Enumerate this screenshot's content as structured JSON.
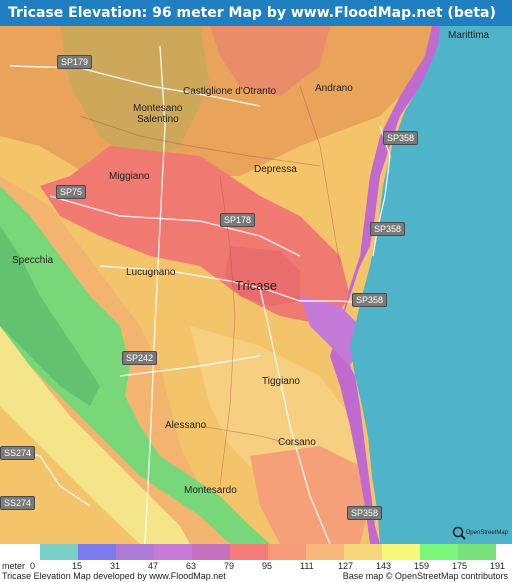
{
  "title": "Tricase Elevation: 96 meter Map by www.FloodMap.net (beta)",
  "places": {
    "marittima": "Marittima",
    "castiglione": "Castiglione d'Otranto",
    "andrano": "Andrano",
    "montesano_1": "Montesano",
    "montesano_2": "Salentino",
    "miggiano": "Miggiano",
    "depressa": "Depressa",
    "specchia": "Specchia",
    "lucugnano": "Lucugnano",
    "tricase": "Tricase",
    "tiggiano": "Tiggiano",
    "alessano": "Alessano",
    "corsano": "Corsano",
    "montesardo": "Montesardo"
  },
  "roads": {
    "sp179": "SP179",
    "sp358_a": "SP358",
    "sp75": "SP75",
    "sp178": "SP178",
    "sp358_b": "SP358",
    "sp358_c": "SP358",
    "sp242": "SP242",
    "ss274_a": "SS274",
    "ss274_b": "SS274",
    "sp358_d": "SP358"
  },
  "osm_logo_text": "OpenStreetMap",
  "legend": {
    "unit_label": "meter",
    "colors": [
      "#7ad0c9",
      "#7c7cf0",
      "#b07ad8",
      "#c87ad8",
      "#c870c0",
      "#f57a7a",
      "#f79a7a",
      "#f7b77a",
      "#f7d77a",
      "#f7f77a",
      "#7af77a",
      "#7ae27a"
    ],
    "ticks": [
      "0",
      "15",
      "31",
      "47",
      "63",
      "79",
      "95",
      "111",
      "127",
      "143",
      "159",
      "175",
      "191"
    ]
  },
  "footer": {
    "left": "Tricase Elevation Map developed by www.FloodMap.net",
    "right": "Base map © OpenStreetMap contributors"
  }
}
